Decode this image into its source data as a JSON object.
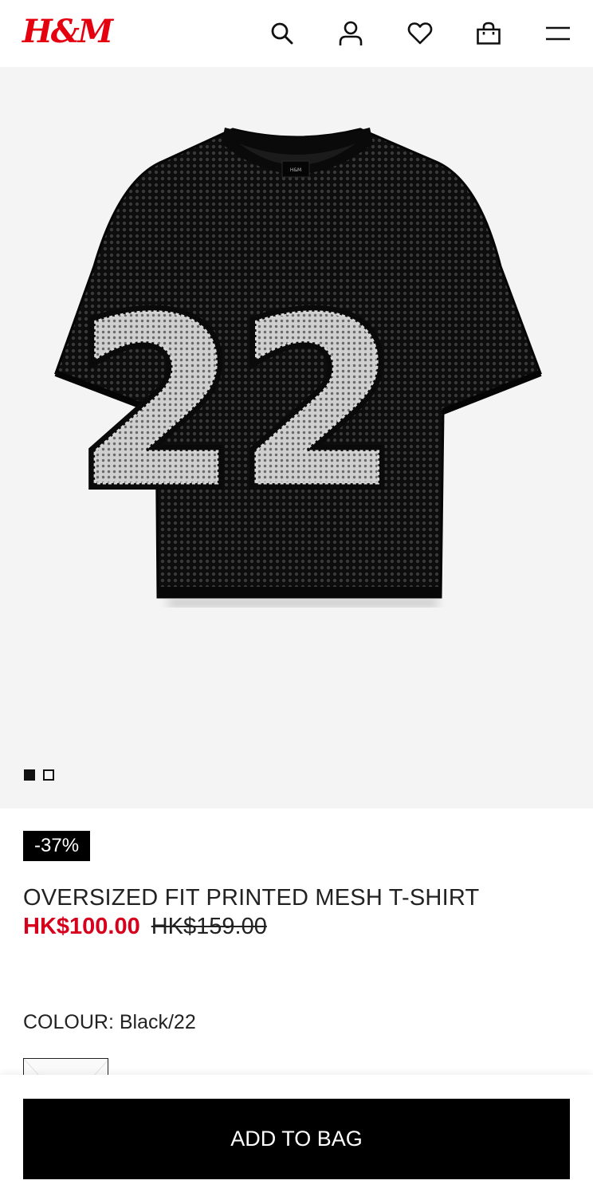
{
  "header": {
    "logo": "H&M",
    "icons": [
      "search-icon",
      "account-icon",
      "heart-icon",
      "shopping-bag-icon",
      "menu-icon"
    ]
  },
  "gallery": {
    "jersey_number": "22",
    "image_count": 2,
    "current_image": 1
  },
  "product": {
    "discount": "-37%",
    "title": "OVERSIZED FIT PRINTED MESH T-SHIRT",
    "price_sale": "HK$100.00",
    "price_original": "HK$159.00",
    "colour_label": "COLOUR: Black/22"
  },
  "cta": {
    "add_to_bag": "ADD TO BAG"
  },
  "colors": {
    "brand_red": "#e50010",
    "sale_red": "#d6001c",
    "button_bg": "#000000",
    "gallery_bg": "#f4f4f4"
  }
}
